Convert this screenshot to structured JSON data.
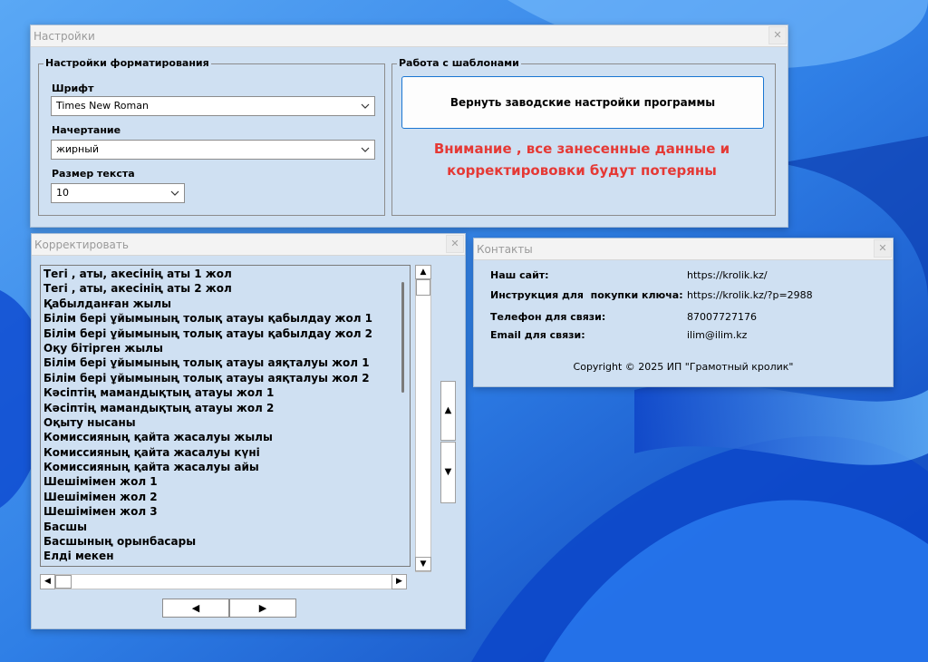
{
  "colors": {
    "dialog_bg": "#cfe0f2",
    "warning": "#e53935",
    "accent_border": "#1a76d2"
  },
  "settings_window": {
    "title": "Настройки",
    "close_label": "✕",
    "formatting_group": {
      "legend": "Настройки форматирования",
      "font_label": "Шрифт",
      "font_value": "Times New Roman",
      "style_label": "Начертание",
      "style_value": "жирный",
      "size_label": "Размер текста",
      "size_value": "10"
    },
    "templates_group": {
      "legend": "Работа с шаблонами",
      "reset_button": "Вернуть заводские настройки программы",
      "warning_line1": "Внимание , все занесенные данные и",
      "warning_line2": "корректирововки будут потеряны"
    }
  },
  "correct_window": {
    "title": "Корректировать",
    "close_label": "✕",
    "items": [
      "Тегі , аты, акесінің аты 1 жол",
      "Тегі , аты, акесінің аты 2 жол",
      "Қабылданған жылы",
      "Білім бері ұйымының толық атауы қабылдау жол 1",
      "Білім бері ұйымының толық атауы қабылдау жол 2",
      "Оқу бітірген жылы",
      "Білім бері ұйымының толық атауы аяқталуы жол 1",
      "Білім бері ұйымының толық атауы аяқталуы жол 2",
      "Кәсіптің мамандықтың атауы жол 1",
      "Кәсіптің мамандықтың атауы жол 2",
      "Оқыту нысаны",
      "Комиссияның қайта жасалуы жылы",
      "Комиссияның қайта жасалуы күні",
      "Комиссияның қайта жасалуы айы",
      "Шешімімен жол 1",
      "Шешімімен жол 2",
      "Шешімімен жол 3",
      "Басшы",
      "Басшының орынбасары",
      "Елді мекен"
    ],
    "scroll_up": "▲",
    "scroll_down": "▼",
    "scroll_left": "◀",
    "scroll_right": "▶",
    "move_up": "▲",
    "move_down": "▼",
    "prev_button": "◀",
    "next_button": "▶"
  },
  "contacts_window": {
    "title": "Контакты",
    "close_label": "✕",
    "site_label": "Наш сайт:",
    "site_value": "https://krolik.kz/",
    "instruction_label": "Инструкция для  покупки ключа:",
    "instruction_value": "https://krolik.kz/?p=2988",
    "phone_label": "Телефон для связи:",
    "phone_value": "87007727176",
    "email_label": "Email для связи:",
    "email_value": "ilim@ilim.kz",
    "copyright": "Copyright © 2025 ИП \"Грамотный кролик\""
  }
}
